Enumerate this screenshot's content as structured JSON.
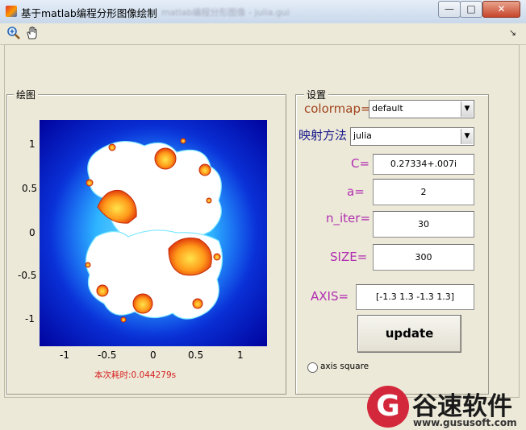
{
  "window": {
    "title": "基于matlab编程分形图像绘制",
    "blurred_title": "matlab编程分形图像 - julia.gui",
    "controls": {
      "minimize": "—",
      "maximize": "□",
      "close": "✕"
    }
  },
  "toolbar": {
    "zoom_icon": "zoom-in-icon",
    "pan_icon": "pan-hand-icon",
    "dock_glyph": "↘"
  },
  "plot_panel": {
    "title": "绘图",
    "y_ticks": [
      "1",
      "0.5",
      "0",
      "-0.5",
      "-1"
    ],
    "x_ticks": [
      "-1",
      "-0.5",
      "0",
      "0.5",
      "1"
    ],
    "elapsed_text": "本次耗时:0.044279s"
  },
  "settings_panel": {
    "title": "设置",
    "colormap_label": "colormap=",
    "colormap_value": "default",
    "mapping_label": "映射方法",
    "mapping_value": "julia",
    "c_label": "C=",
    "c_value": "0.27334+.007i",
    "a_label": "a=",
    "a_value": "2",
    "niter_label": "n_iter=",
    "niter_value": "30",
    "size_label": "SIZE=",
    "size_value": "300",
    "axis_label": "AXIS=",
    "axis_value": "[-1.3 1.3 -1.3 1.3]",
    "update_label": "update",
    "axis_square_label": "axis square",
    "axis_square_checked": false
  },
  "watermark": {
    "brand": "谷速软件",
    "url": "www.gususoft.com",
    "letter": "G"
  },
  "colors": {
    "label_magenta": "#b12fb1",
    "label_navy": "#1a1a8c",
    "colormap_label": "#a0431e",
    "elapsed_red": "#d62020"
  }
}
